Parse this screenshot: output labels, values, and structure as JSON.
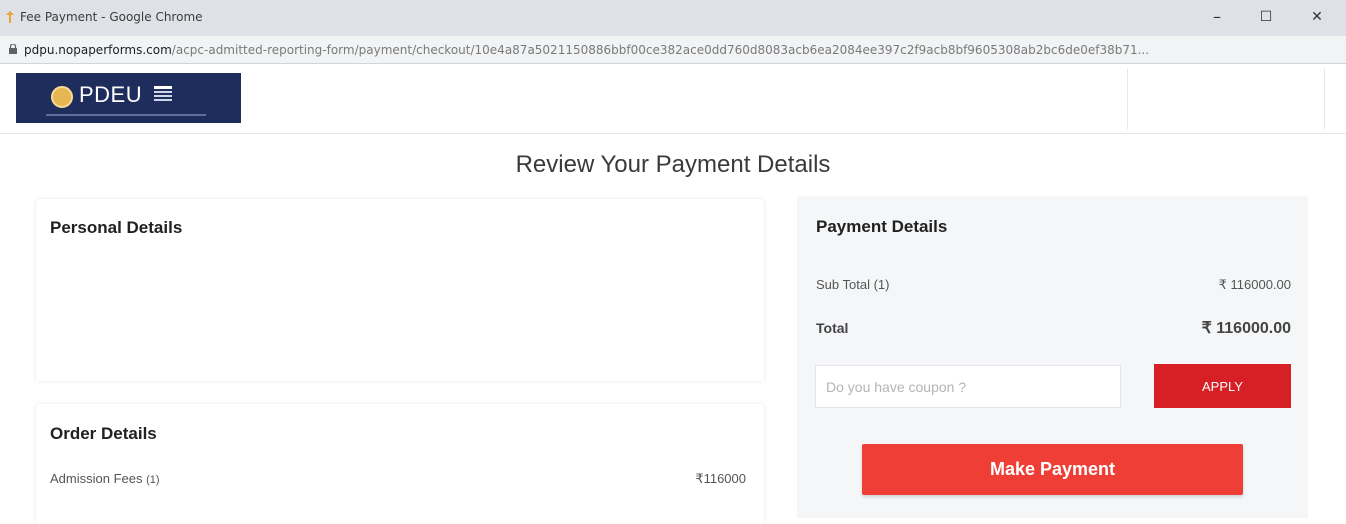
{
  "window": {
    "title": "Fee Payment - Google Chrome",
    "minimize": "–",
    "maximize": "☐",
    "close": "✕"
  },
  "address": {
    "host": "pdpu.nopaperforms.com",
    "path": "/acpc-admitted-reporting-form/payment/checkout/10e4a87a5021150886bbf00ce382ace0dd760d8083acb6ea2084ee397c2f9acb8bf9605308ab2bc6de0ef38b71..."
  },
  "header": {
    "logo_text": "PDEU"
  },
  "page": {
    "title": "Review Your Payment Details"
  },
  "personal": {
    "title": "Personal Details"
  },
  "order": {
    "title": "Order Details",
    "item_label": "Admission Fees",
    "item_qty": "(1)",
    "item_amount": "₹116000"
  },
  "payment": {
    "title": "Payment Details",
    "subtotal_label": "Sub Total (1)",
    "subtotal_value": "₹ 116000.00",
    "total_label": "Total",
    "total_value": "₹ 116000.00",
    "coupon_placeholder": "Do you have coupon ?",
    "apply_label": "APPLY",
    "make_payment_label": "Make Payment"
  },
  "colors": {
    "titlebar": "#dee1e6",
    "logo_bg": "#1f2d5c",
    "apply_bg": "#d71f26",
    "pay_bg": "#ef3e36",
    "panel_bg": "#f4f6f8"
  },
  "icons": {
    "favicon": "favicon-icon",
    "lock": "lock-icon",
    "emblem": "emblem-icon"
  }
}
